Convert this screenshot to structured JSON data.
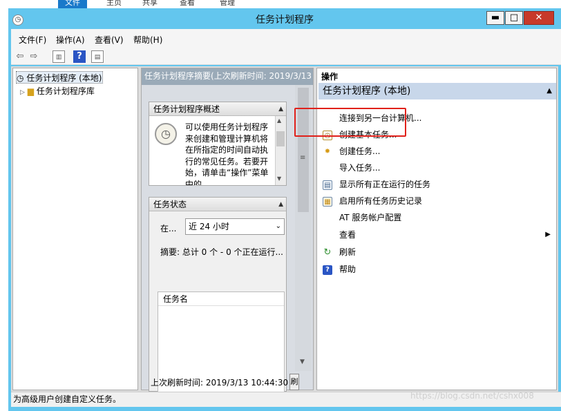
{
  "behind": {
    "tabs": [
      "文件",
      "主页",
      "共享",
      "查看",
      "管理"
    ]
  },
  "window": {
    "title": "任务计划程序",
    "minimize": "▬",
    "maximize": "□",
    "close": "✕"
  },
  "menu": [
    "文件(F)",
    "操作(A)",
    "查看(V)",
    "帮助(H)"
  ],
  "tree": {
    "items": [
      "任务计划程序 (本地)",
      "任务计划程序库"
    ]
  },
  "center": {
    "header": "任务计划程序摘要(上次刷新时间: 2019/3/13",
    "overview": {
      "title": "任务计划程序概述",
      "text": "可以使用任务计划程序来创建和管理计算机将在所指定的时间自动执行的常见任务。若要开始，请单击“操作”菜单中的"
    },
    "status": {
      "title": "任务状态",
      "in_label": "在...",
      "in_value": "近 24 小时",
      "summary": "摘要: 总计 0 个 - 0 个正在运行...",
      "col_taskname": "任务名"
    },
    "last_refresh": "上次刷新时间: 2019/3/13 10:44:30",
    "refresh_btn": "刷"
  },
  "actions": {
    "label": "操作",
    "group": "任务计划程序 (本地)",
    "items": [
      "连接到另一台计算机...",
      "创建基本任务...",
      "创建任务...",
      "导入任务...",
      "显示所有正在运行的任务",
      "启用所有任务历史记录",
      "AT 服务帐户配置",
      "查看",
      "刷新",
      "帮助"
    ]
  },
  "statusbar": "为高级用户创建自定义任务。",
  "watermark": "https://blog.csdn.net/cshx008"
}
